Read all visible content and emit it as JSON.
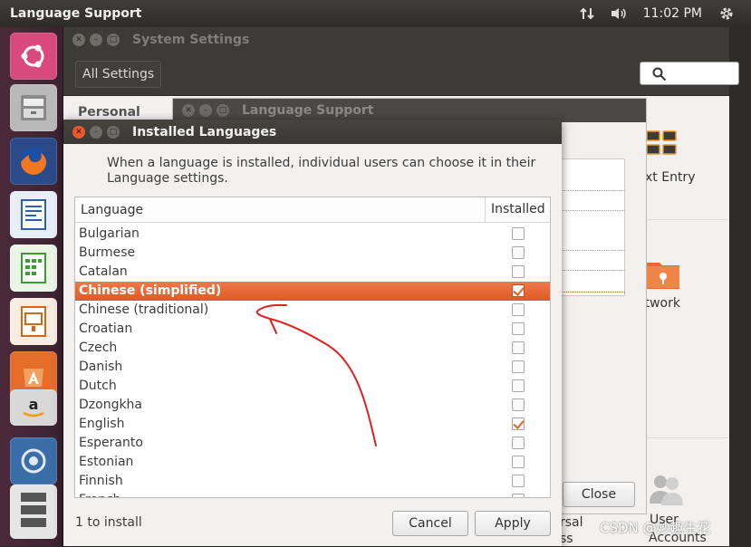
{
  "top_panel": {
    "app_title": "Language Support",
    "clock": "11:02 PM",
    "icons": [
      "network-arrows-icon",
      "volume-icon",
      "gear-icon"
    ]
  },
  "launcher": {
    "items": [
      "ubuntu-logo-icon",
      "files-icon",
      "firefox-icon",
      "writer-icon",
      "calc-icon",
      "impress-icon",
      "software-center-icon",
      "amazon-icon",
      "system-settings-icon",
      "dvd-icon"
    ]
  },
  "system_settings": {
    "title": "System Settings",
    "all_settings": "All Settings",
    "section_personal": "Personal",
    "text_entry": "xt Entry",
    "network": "etwork",
    "universal": "rsal\nss",
    "accounts": "Accounts",
    "accounts_top": "User"
  },
  "language_support": {
    "title": "Language Support",
    "close": "Close"
  },
  "installed_languages": {
    "title": "Installed Languages",
    "description": "When a language is installed, individual users can choose it in their Language settings.",
    "col_language": "Language",
    "col_installed": "Installed",
    "rows": [
      {
        "name": "Bulgarian",
        "installed": false
      },
      {
        "name": "Burmese",
        "installed": false
      },
      {
        "name": "Catalan",
        "installed": false
      },
      {
        "name": "Chinese (simplified)",
        "installed": true,
        "selected": true
      },
      {
        "name": "Chinese (traditional)",
        "installed": false
      },
      {
        "name": "Croatian",
        "installed": false
      },
      {
        "name": "Czech",
        "installed": false
      },
      {
        "name": "Danish",
        "installed": false
      },
      {
        "name": "Dutch",
        "installed": false
      },
      {
        "name": "Dzongkha",
        "installed": false
      },
      {
        "name": "English",
        "installed": true
      },
      {
        "name": "Esperanto",
        "installed": false
      },
      {
        "name": "Estonian",
        "installed": false
      },
      {
        "name": "Finnish",
        "installed": false
      },
      {
        "name": "French",
        "installed": false
      }
    ],
    "install_count": "1 to install",
    "cancel": "Cancel",
    "apply": "Apply"
  },
  "watermark": "CSDN @妙趣生花",
  "colors": {
    "accent": "#dd4814",
    "selection": "#e96a36",
    "annotation": "#e02020",
    "launcher": "#4b2a3a"
  }
}
